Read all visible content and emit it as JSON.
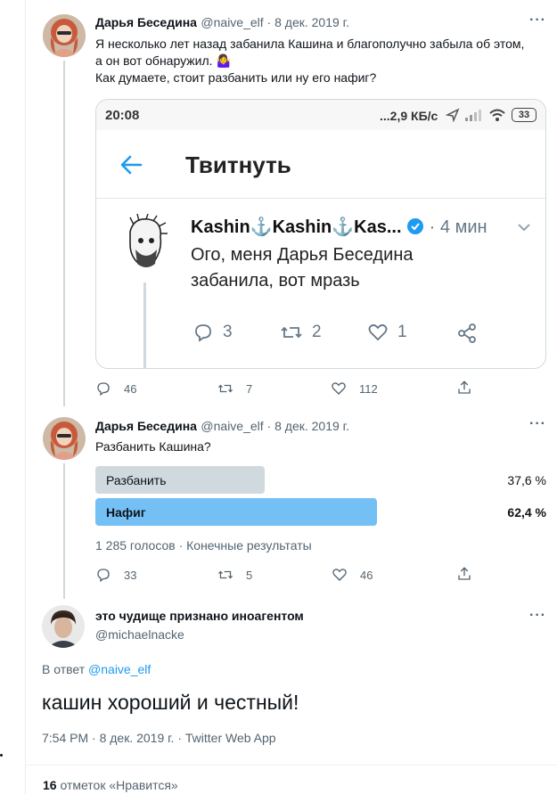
{
  "tweet1": {
    "author_name": "Дарья Беседина",
    "handle_date": "@naive_elf · 8 дек. 2019 г.",
    "text_line1": "Я несколько лет назад забанила Кашина и благополучно забыла об этом,",
    "text_line2": "а он вот обнаружил. 🤷‍♀️",
    "text_line3": "Как думаете, стоит разбанить или ну его нафиг?",
    "replies": "46",
    "retweets": "7",
    "likes": "112",
    "embedded_screenshot": {
      "status_time": "20:08",
      "status_right": "...2,9 КБ/с",
      "battery": "33",
      "header_title": "Твитнуть",
      "inner_author": "Kashin⚓Kashin⚓Kas...",
      "inner_time": "4 мин",
      "inner_text_line1": "Ого, меня Дарья Беседина",
      "inner_text_line2": "забанила, вот мразь",
      "inner_replies": "3",
      "inner_retweets": "2",
      "inner_likes": "1"
    }
  },
  "tweet2": {
    "author_name": "Дарья Беседина",
    "handle_date": "@naive_elf · 8 дек. 2019 г.",
    "text": "Разбанить Кашина?",
    "poll": {
      "options": [
        {
          "label": "Разбанить",
          "percent_text": "37,6 %",
          "fraction": 0.376,
          "winner": false
        },
        {
          "label": "Нафиг",
          "percent_text": "62,4 %",
          "fraction": 0.624,
          "winner": true
        }
      ],
      "summary": "1 285 голосов · Конечные результаты"
    },
    "replies": "33",
    "retweets": "5",
    "likes": "46"
  },
  "tweet3": {
    "author_name": "это чудище признано иноагентом",
    "handle": "@michaelnacke",
    "reply_prefix": "В ответ",
    "reply_to": "@naive_elf",
    "text": "кашин хороший и честный!",
    "timestamp": "7:54 PM · 8 дек. 2019 г. · Twitter Web App",
    "likes_count": "16",
    "likes_label": "отметок «Нравится»"
  },
  "colors": {
    "accent": "#1d9bf0",
    "poll_winner": "#74c0f5",
    "poll_loser": "#cfd9de"
  }
}
